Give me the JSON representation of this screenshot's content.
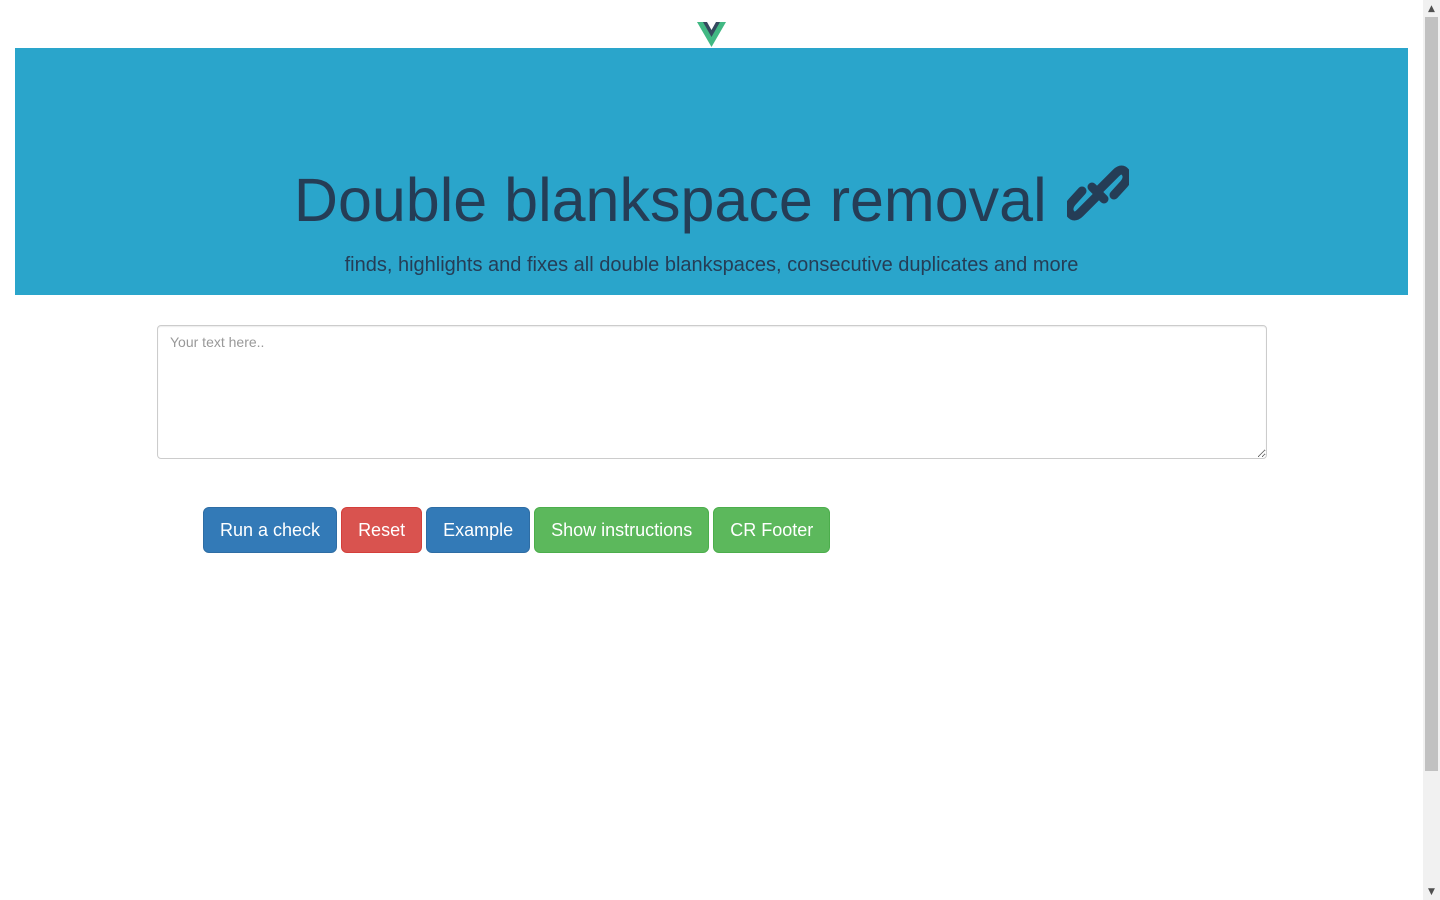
{
  "header": {
    "logo_icon": "vue-logo-icon",
    "logo_colors": {
      "outer": "#41b883",
      "inner": "#34495e"
    }
  },
  "hero": {
    "title": "Double blankspace removal",
    "title_icon": "link-icon",
    "subtitle": "finds, highlights and fixes all double blankspaces, consecutive duplicates and more",
    "background": "#2aa5cb",
    "text_color": "#253d56"
  },
  "editor": {
    "placeholder": "Your text here..",
    "value": ""
  },
  "buttons": {
    "run_check": "Run a check",
    "reset": "Reset",
    "example": "Example",
    "show_instructions": "Show instructions",
    "cr_footer": "CR Footer"
  },
  "colors": {
    "primary": "#337ab7",
    "danger": "#d9534f",
    "success": "#5cb85c"
  }
}
